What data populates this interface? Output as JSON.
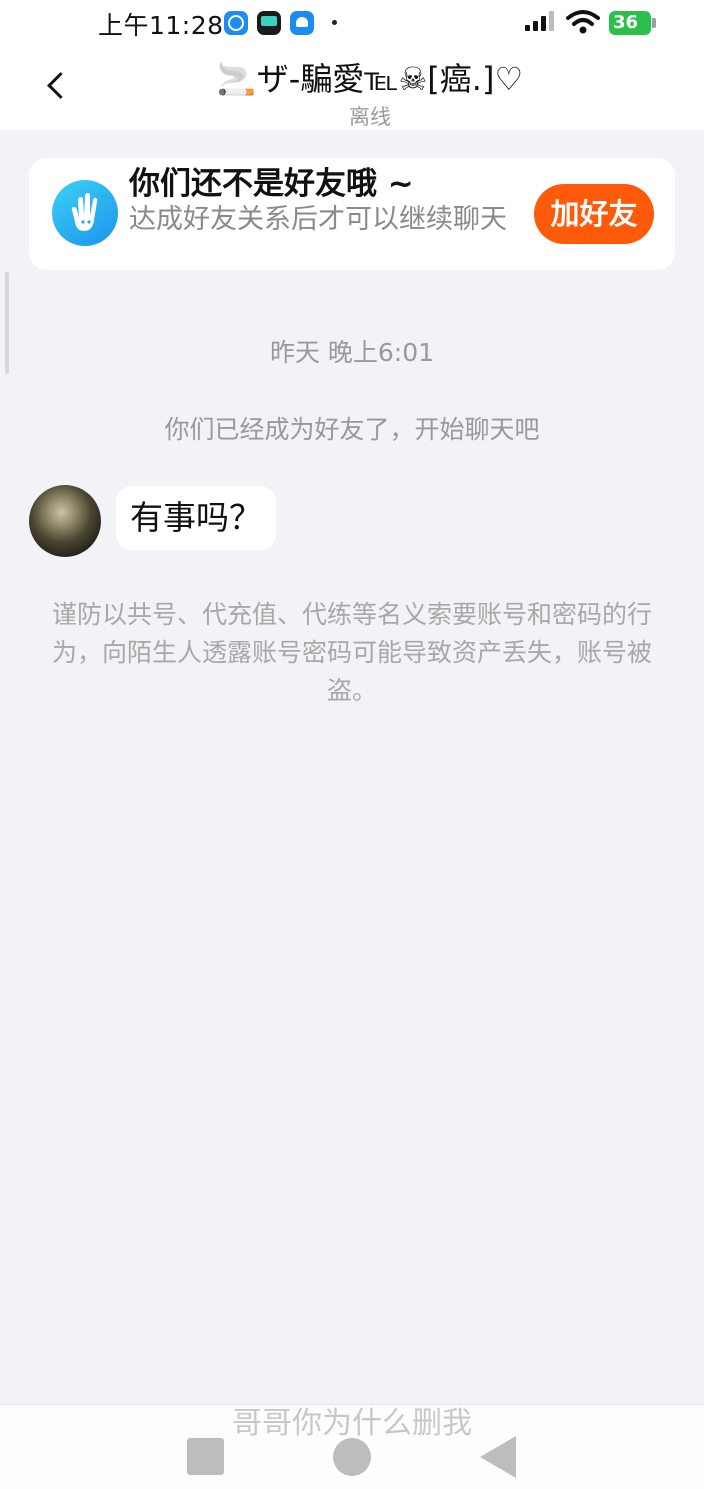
{
  "status_bar": {
    "time": "上午11:28",
    "battery_level": "36",
    "icons": [
      "kuaishou-k-icon",
      "tv-app-icon",
      "android-app-icon",
      "signal-icon",
      "wifi-icon",
      "battery-icon"
    ]
  },
  "header": {
    "title": "🚬ザ-騙愛℡☠[癌.]♡",
    "status": "离线",
    "back_icon": "chevron-left-icon"
  },
  "friend_card": {
    "icon": "wave-hand-icon",
    "title": "你们还不是好友哦 ~",
    "subtitle": "达成好友关系后才可以继续聊天",
    "button_label": "加好友",
    "accent_color": "#ff5a0a"
  },
  "chat": {
    "timestamp": "昨天 晚上6:01",
    "system_message": "你们已经成为好友了，开始聊天吧",
    "messages": [
      {
        "sender": "other",
        "text": "有事吗？"
      }
    ],
    "warning": "谨防以共号、代充值、代练等名义索要账号和密码的行为，向陌生人透露账号密码可能导致资产丢失，账号被盗。"
  },
  "overlay_caption": "哥哥你为什么删我",
  "nav_bar": {
    "icons": [
      "recent-apps-square-icon",
      "home-circle-icon",
      "back-triangle-icon"
    ]
  }
}
